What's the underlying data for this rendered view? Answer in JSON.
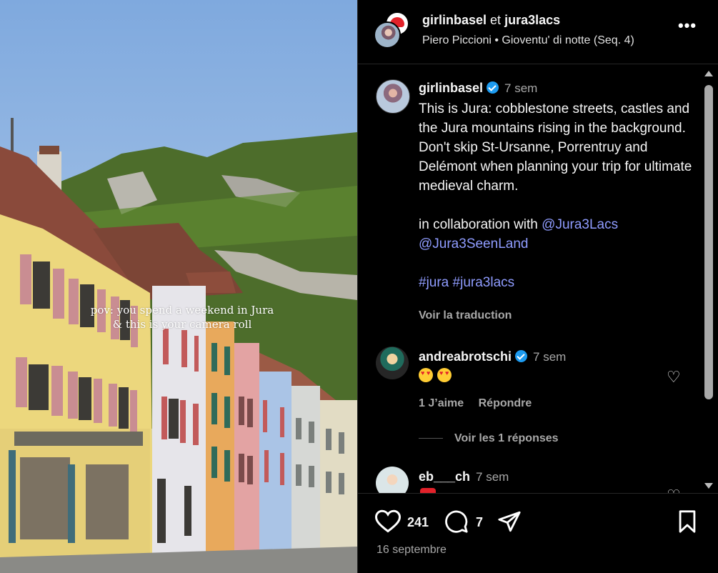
{
  "media": {
    "overlay_line1": "pov: you spend a weekend in Jura",
    "overlay_line2": "& this is your camera roll"
  },
  "header": {
    "user1": "girlinbasel",
    "connector": "et",
    "user2": "jura3lacs",
    "audio": "Piero Piccioni • Gioventu' di notte (Seq. 4)",
    "more_icon": "more-horizontal-icon"
  },
  "caption": {
    "username": "girlinbasel",
    "time": "7 sem",
    "text": "This is Jura: cobblestone streets, castles and the Jura mountains rising in the background. Don't skip St-Ursanne, Porrentruy and Delémont when planning your trip for ultimate medieval charm.",
    "collab_prefix": "in collaboration with",
    "mention1": "@Jura3Lacs",
    "mention2": "@Jura3SeenLand",
    "hashtags": "#jura #jura3lacs",
    "translate": "Voir la traduction"
  },
  "comments": [
    {
      "username": "andreabrotschi",
      "time": "7 sem",
      "like_label": "1 J’aime",
      "reply_label": "Répondre",
      "view_replies": "Voir les 1 réponses"
    },
    {
      "username": "eb___ch",
      "time": "7 sem"
    }
  ],
  "actions": {
    "likes": "241",
    "comments": "7",
    "date": "16 septembre"
  },
  "colors": {
    "background": "#000000",
    "link": "#8f9cff",
    "verified": "#1d9bf0",
    "muted": "#a8a8a8"
  }
}
